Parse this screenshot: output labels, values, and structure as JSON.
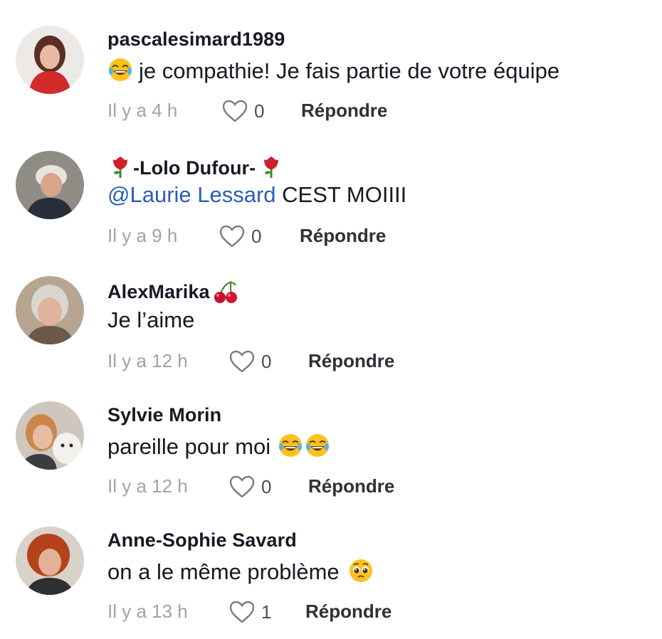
{
  "comments": [
    {
      "author": "pascalesimard1989",
      "text_emoji": "laughing-tears",
      "text": "je compathie! Je fais partie de votre équipe",
      "time": "Il y a 4 h",
      "likes": "0",
      "reply_label": "Répondre"
    },
    {
      "author_prefix_emoji": "rose",
      "author": "-Lolo Dufour-",
      "author_suffix_emoji": "rose",
      "mention": "@Laurie Lessard",
      "text": " CEST MOIIII",
      "time": "Il y a 9 h",
      "likes": "0",
      "reply_label": "Répondre"
    },
    {
      "author": "AlexMarika",
      "author_suffix_emoji": "cherries",
      "text": "Je l’aime",
      "time": "Il y a 12 h",
      "likes": "0",
      "reply_label": "Répondre"
    },
    {
      "author": "Sylvie Morin",
      "text": "pareille pour moi",
      "text_suffix_emojis": [
        "laughing-tears",
        "laughing-tears"
      ],
      "time": "Il y a 12 h",
      "likes": "0",
      "reply_label": "Répondre"
    },
    {
      "author": "Anne-Sophie Savard",
      "text": "on a le même problème",
      "text_suffix_emojis": [
        "pleading-face"
      ],
      "time": "Il y a 13 h",
      "likes": "1",
      "reply_label": "Répondre"
    }
  ],
  "colors": {
    "mention": "#2b5db9",
    "muted": "#a2a3a7",
    "text": "#161823"
  }
}
